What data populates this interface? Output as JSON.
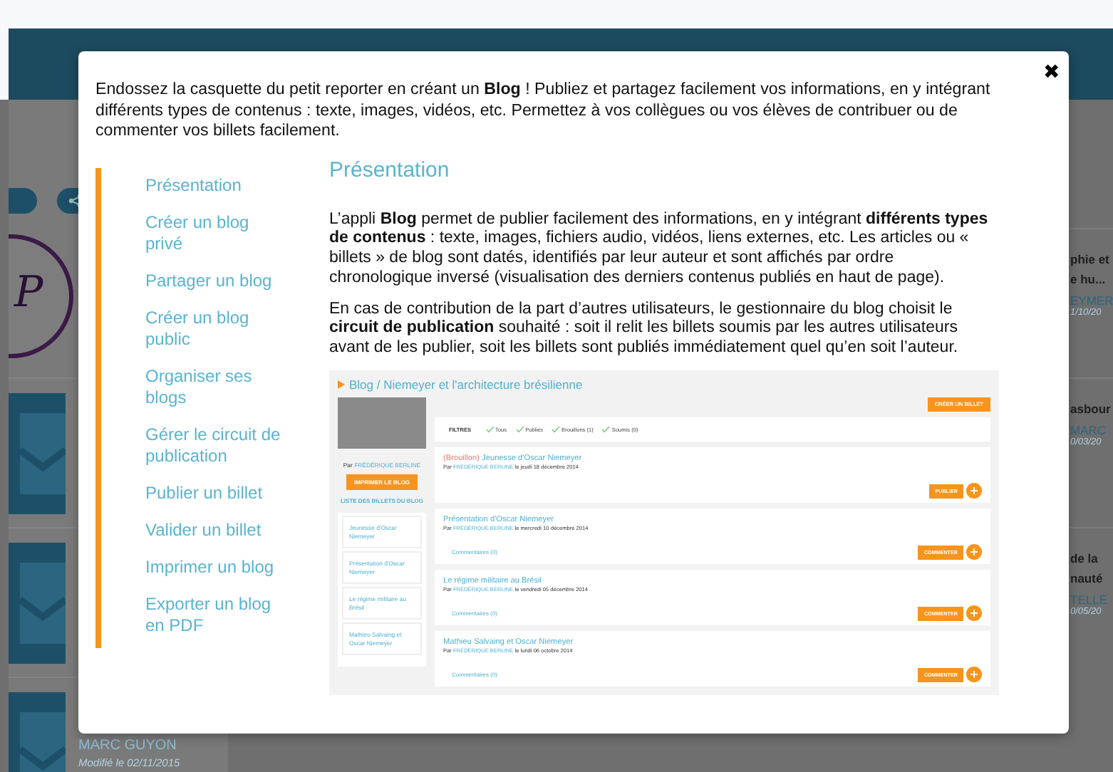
{
  "background_page": {
    "logo_letter": "P",
    "right_items": [
      {
        "title_lines": [
          "phie et",
          "e hu..."
        ],
        "author": "EYMER",
        "date": "1/10/20"
      },
      {
        "title_lines": [
          "asbour"
        ],
        "author": "MARC",
        "date": "0/03/20"
      },
      {
        "title_lines": [
          "de la",
          "nauté"
        ],
        "author": "TELLE",
        "date": "0/05/20"
      }
    ],
    "bottom_item": {
      "author": "MARC GUYON",
      "date": "Modifié le 02/11/2015"
    }
  },
  "dialog": {
    "close": "✖",
    "intro": "Endossez la casquette du petit reporter en créant un **Blog** ! Publiez et partagez facilement vos informations, en y intégrant différents types de contenus : texte, images, vidéos, etc. Permettez à vos collègues ou vos élèves de contribuer ou de commenter vos billets facilement.",
    "nav": [
      "Présentation",
      "Créer un blog privé",
      "Partager un blog",
      "Créer un blog public",
      "Organiser ses blogs",
      "Gérer le circuit de publication",
      "Publier un billet",
      "Valider un billet",
      "Imprimer un blog",
      "Exporter un blog en PDF"
    ],
    "heading": "Présentation",
    "paragraphs": [
      "L’appli **Blog** permet de publier facilement des informations, en y intégrant **différents types de contenus** : texte, images, fichiers audio, vidéos, liens externes, etc. Les articles ou « billets » de blog sont datés, identifiés par leur auteur et sont affichés par ordre chronologique inversé (visualisation des derniers contenus publiés en haut de page).",
      "En cas de contribution de la part d’autres utilisateurs, le gestionnaire du blog choisit le **circuit de publication** souhaité : soit il relit les billets soumis par les autres utilisateurs avant de les publier, soit les billets sont publiés immédiatement quel qu’en soit l’auteur."
    ],
    "screenshot": {
      "title": "Blog / Niemeyer et l'architecture brésilienne",
      "byline_prefix": "Par",
      "owner": "FRÉDÉRIQUE BERLINE",
      "print_button": "IMPRIMER LE BLOG",
      "list_title": "LISTE DES BILLETS DU BLOG",
      "list": [
        "Jeunesse d'Oscar Niemeyer",
        "Présentation d'Oscar Niemeyer",
        "Le régime militaire au Brésil",
        "Mathieu Salvaing et Oscar Niemeyer"
      ],
      "create_button": "CRÉER UN BILLET",
      "filters_label": "FILTRES",
      "filters": [
        {
          "label": "Tous",
          "checked": true
        },
        {
          "label": "Publiés",
          "checked": true
        },
        {
          "label": "Brouillons (1)",
          "checked": true
        },
        {
          "label": "Soumis (0)",
          "checked": true
        }
      ],
      "posts": [
        {
          "status": "(Brouillon)",
          "title": "Jeunesse d'Oscar Niemeyer",
          "byline_prefix": "Par",
          "author": "FRÉDÉRIQUE BERLINE",
          "date": "le jeudi 18 décembre 2014",
          "action": "PUBLIER"
        },
        {
          "title": "Présentation d'Oscar Niemeyer",
          "byline_prefix": "Par",
          "author": "FRÉDÉRIQUE BERLINE",
          "date": "le mercredi 10 décembre 2014",
          "comments": "Commentaires (0)",
          "action": "COMMENTER"
        },
        {
          "title": "Le régime militaire au Brésil",
          "byline_prefix": "Par",
          "author": "FRÉDÉRIQUE BERLINE",
          "date": "le vendredi 05 décembre 2014",
          "comments": "Commentaires (0)",
          "action": "COMMENTER"
        },
        {
          "title": "Mathieu Salvaing et Oscar Niemeyer",
          "byline_prefix": "Par",
          "author": "FRÉDÉRIQUE BERLINE",
          "date": "le lundi 06 octobre 2014",
          "comments": "Commentaires (0)",
          "action": "COMMENTER"
        }
      ]
    }
  }
}
